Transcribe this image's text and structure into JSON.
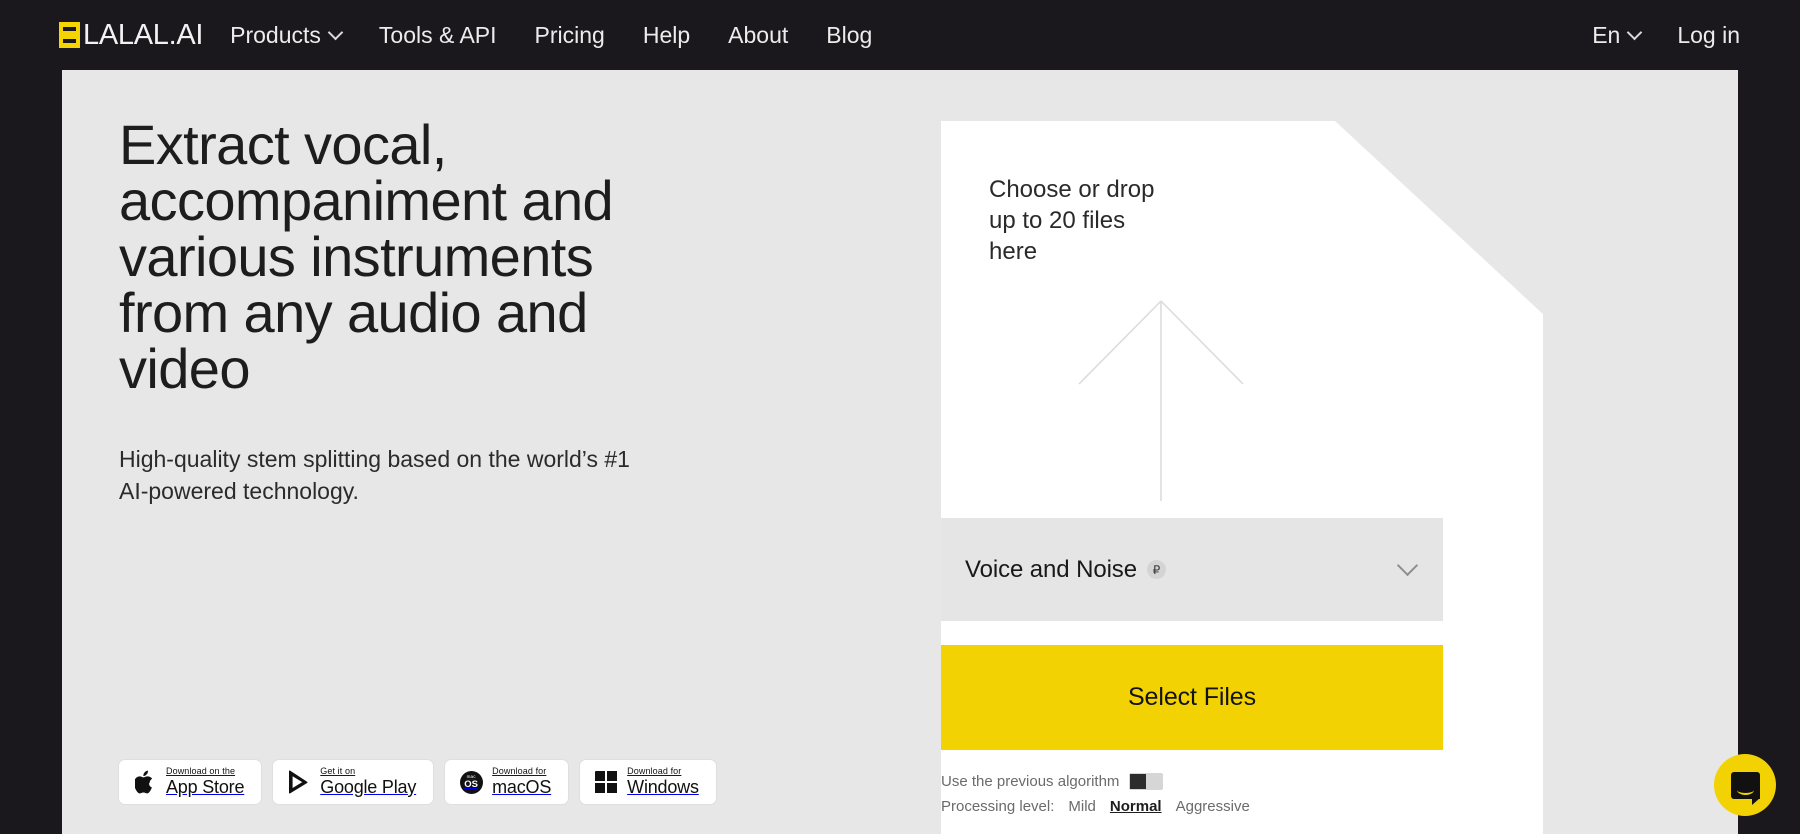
{
  "header": {
    "brand": "LALAL.AI",
    "brand_icon": "lalal-logo-icon",
    "nav": [
      {
        "label": "Products",
        "has_chevron": true
      },
      {
        "label": "Tools & API",
        "has_chevron": false
      },
      {
        "label": "Pricing",
        "has_chevron": false
      },
      {
        "label": "Help",
        "has_chevron": false
      },
      {
        "label": "About",
        "has_chevron": false
      },
      {
        "label": "Blog",
        "has_chevron": false
      }
    ],
    "language": "En",
    "login": "Log in"
  },
  "hero": {
    "heading": "Extract vocal, accompaniment and various instruments from any audio and video",
    "subheading": "High-quality stem splitting based on the world’s #1 AI-powered technology."
  },
  "badges": [
    {
      "icon": "apple-icon",
      "small": "Download on the",
      "big": "App Store"
    },
    {
      "icon": "google-play-icon",
      "small": "Get it on",
      "big": "Google Play"
    },
    {
      "icon": "macos-icon",
      "small": "Download for",
      "big": "macOS",
      "circle_top": "mac",
      "circle_bottom": "OS"
    },
    {
      "icon": "windows-icon",
      "small": "Download for",
      "big": "Windows"
    }
  ],
  "upload": {
    "title": "Choose or drop\nup to 20 files\nhere",
    "arrow_icon": "upload-arrow-icon",
    "stem_select": {
      "value": "Voice and Noise",
      "badge": "₽",
      "chevron_icon": "chevron-down-icon"
    },
    "cta": "Select Files",
    "previous_algorithm_label": "Use the previous algorithm",
    "previous_algorithm_state": "off",
    "processing_level_label": "Processing level:",
    "processing_levels": [
      "Mild",
      "Normal",
      "Aggressive"
    ],
    "processing_level_selected": "Normal"
  },
  "chat": {
    "icon": "chat-bubble-icon",
    "label": "Open chat"
  },
  "colors": {
    "header_bg": "#1b181d",
    "content_bg": "#e7e7e7",
    "card_bg": "#ffffff",
    "accent": "#F2D202",
    "dropdown_bg": "#e5e5e5",
    "text_primary": "#1d1d1d",
    "text_muted": "#6b6b6b"
  }
}
